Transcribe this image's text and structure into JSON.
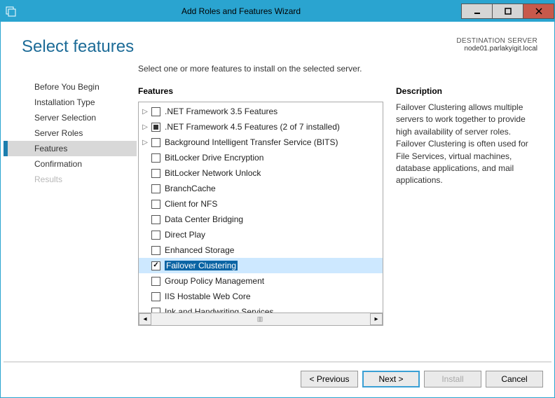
{
  "window": {
    "title": "Add Roles and Features Wizard"
  },
  "header": {
    "page_title": "Select features",
    "dest_label": "DESTINATION SERVER",
    "dest_server": "node01.parlakyigit.local"
  },
  "sidebar": {
    "items": [
      {
        "label": "Before You Begin",
        "state": "normal"
      },
      {
        "label": "Installation Type",
        "state": "normal"
      },
      {
        "label": "Server Selection",
        "state": "normal"
      },
      {
        "label": "Server Roles",
        "state": "normal"
      },
      {
        "label": "Features",
        "state": "active"
      },
      {
        "label": "Confirmation",
        "state": "normal"
      },
      {
        "label": "Results",
        "state": "disabled"
      }
    ]
  },
  "main": {
    "instruction": "Select one or more features to install on the selected server.",
    "features_heading": "Features",
    "description_heading": "Description",
    "description_text": "Failover Clustering allows multiple servers to work together to provide high availability of server roles. Failover Clustering is often used for File Services, virtual machines, database applications, and mail applications.",
    "features": [
      {
        "label": ".NET Framework 3.5 Features",
        "expandable": true,
        "check": "unchecked"
      },
      {
        "label": ".NET Framework 4.5 Features (2 of 7 installed)",
        "expandable": true,
        "check": "partial"
      },
      {
        "label": "Background Intelligent Transfer Service (BITS)",
        "expandable": true,
        "check": "unchecked"
      },
      {
        "label": "BitLocker Drive Encryption",
        "expandable": false,
        "check": "unchecked"
      },
      {
        "label": "BitLocker Network Unlock",
        "expandable": false,
        "check": "unchecked"
      },
      {
        "label": "BranchCache",
        "expandable": false,
        "check": "unchecked"
      },
      {
        "label": "Client for NFS",
        "expandable": false,
        "check": "unchecked"
      },
      {
        "label": "Data Center Bridging",
        "expandable": false,
        "check": "unchecked"
      },
      {
        "label": "Direct Play",
        "expandable": false,
        "check": "unchecked"
      },
      {
        "label": "Enhanced Storage",
        "expandable": false,
        "check": "unchecked"
      },
      {
        "label": "Failover Clustering",
        "expandable": false,
        "check": "checked",
        "selected": true
      },
      {
        "label": "Group Policy Management",
        "expandable": false,
        "check": "unchecked"
      },
      {
        "label": "IIS Hostable Web Core",
        "expandable": false,
        "check": "unchecked"
      },
      {
        "label": "Ink and Handwriting Services",
        "expandable": false,
        "check": "unchecked"
      }
    ]
  },
  "footer": {
    "previous": "< Previous",
    "next": "Next >",
    "install": "Install",
    "cancel": "Cancel"
  }
}
